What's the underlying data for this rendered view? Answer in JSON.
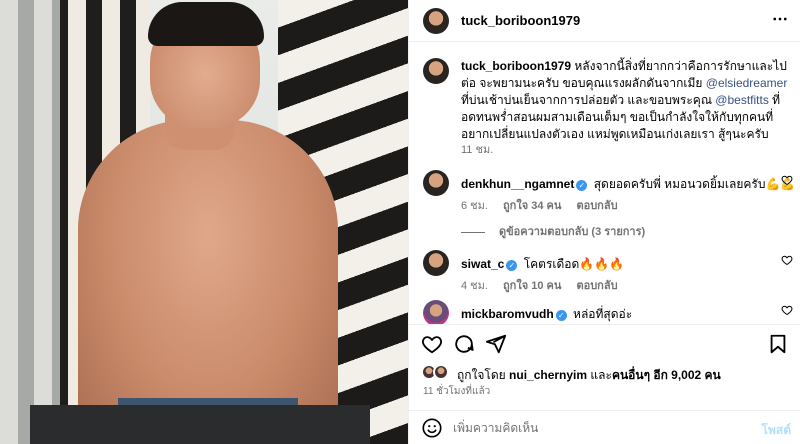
{
  "post": {
    "username": "tuck_boriboon1979",
    "more_icon": "more-horizontal-icon",
    "caption_parts": [
      "หลังจากนี้สิ่งที่ยากกว่าคือการรักษาและไปต่อ จะพยามนะครับ ขอบคุณแรงผลักดันจากเมีย ",
      "@elsiedreamer",
      " ที่บ่นเช้าบ่นเย็นจากการปล่อยตัว และขอบพระคุณ ",
      "@bestfitts",
      " ที่อดทนพร่ำสอนผมสามเดือนเต็มๆ ขอเป็นกำลังใจให้กับทุกคนที่อยากเปลี่ยนแปลงตัวเอง แหม่พูดเหมือนเก่งเลยเรา สู้ๆนะครับ"
    ],
    "caption_time": "11 ชม.",
    "accent": "#385185"
  },
  "comments": [
    {
      "username": "denkhun__ngamnet",
      "text": "สุดยอดครับพี่ หมอนวดยิ้มเลยครับ💪💪",
      "time": "6 ชม.",
      "likes": "ถูกใจ 34 คน",
      "reply": "ตอบกลับ"
    },
    {
      "username": "siwat_c",
      "text": "โคตรเดือด🔥🔥🔥",
      "time": "4 ชม.",
      "likes": "ถูกใจ 10 คน",
      "reply": "ตอบกลับ"
    },
    {
      "username": "mickbaromvudh",
      "text": "หล่อที่สุดอ่ะ"
    }
  ],
  "view_replies": "ดูข้อความตอบกลับ (3 รายการ)",
  "likes": {
    "prefix": "ถูกใจโดย ",
    "user": "nui_chernyim",
    "middle": " และ",
    "others": "คนอื่นๆ อีก 9,002 คน"
  },
  "post_time": "11 ชั่วโมงที่แล้ว",
  "composer": {
    "placeholder": "เพิ่มความคิดเห็น",
    "post_label": "โพสต์",
    "post_color": "#b2dffc"
  },
  "colors": {
    "verified": "#3897f0",
    "secondary_text": "#737373",
    "divider": "#efefef"
  }
}
